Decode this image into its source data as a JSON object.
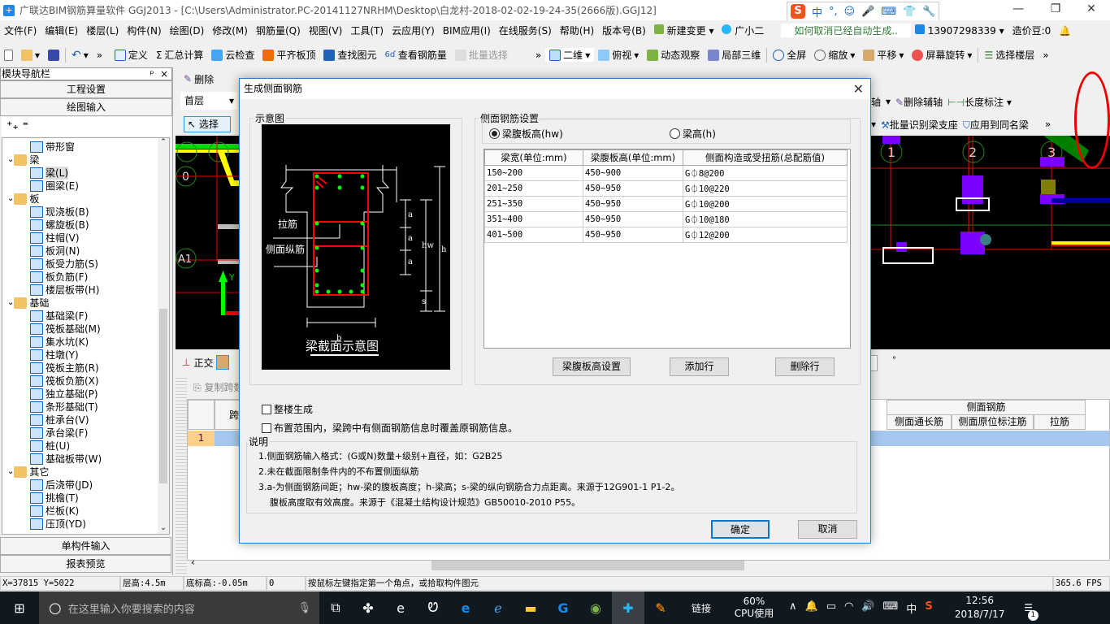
{
  "window": {
    "title": "广联达BIM钢筋算量软件 GGJ2013 - [C:\\Users\\Administrator.PC-20141127NRHM\\Desktop\\白龙村-2018-02-02-19-24-35(2666版).GGJ12]",
    "minimize": "—",
    "restore": "❐",
    "close": "✕"
  },
  "ime": {
    "logo": "S",
    "items": [
      "中",
      "°,",
      "☺",
      "🎤",
      "⌨",
      "👕",
      "🔧"
    ]
  },
  "menu": {
    "items": [
      "文件(F)",
      "编辑(E)",
      "楼层(L)",
      "构件(N)",
      "绘图(D)",
      "修改(M)",
      "钢筋量(Q)",
      "视图(V)",
      "工具(T)",
      "云应用(Y)",
      "BIM应用(I)",
      "在线服务(S)",
      "帮助(H)",
      "版本号(B)"
    ],
    "new_change": "新建变更",
    "assistant": "广小二",
    "hint_link": "如何取消已经自动生成..",
    "account": "13907298339",
    "beans": "造价豆:0"
  },
  "toolbar": {
    "items": [
      "定义",
      "汇总计算",
      "云检查",
      "平齐板顶",
      "查找图元",
      "查看钢筋量",
      "批量选择"
    ],
    "view_items": [
      "二维",
      "俯视",
      "动态观察",
      "局部三维",
      "全屏",
      "缩放",
      "平移",
      "屏幕旋转",
      "选择楼层"
    ]
  },
  "draw_toolbar": {
    "delete": "删除",
    "floor": "首层",
    "select": "选择",
    "delete_aux": "删除辅轴",
    "length_dim": "长度标注",
    "batch_identify": "批量识别梁支座",
    "apply_same": "应用到同名梁",
    "ortho": "正交",
    "copy_span": "复制跨数据",
    "aux_partial": "辅轴"
  },
  "nav": {
    "title": "模块导航栏",
    "pin": "ᵖ",
    "close": "×",
    "project_settings": "工程设置",
    "drawing_input": "绘图输入",
    "single_input": "单构件输入",
    "report_preview": "报表预览",
    "tree": [
      {
        "label": "带形窗",
        "type": "leaf",
        "level": 2
      },
      {
        "label": "梁",
        "type": "folder",
        "level": 1
      },
      {
        "label": "梁(L)",
        "type": "leaf",
        "level": 2,
        "selected": true
      },
      {
        "label": "圈梁(E)",
        "type": "leaf",
        "level": 2
      },
      {
        "label": "板",
        "type": "folder",
        "level": 1
      },
      {
        "label": "现浇板(B)",
        "type": "leaf",
        "level": 2
      },
      {
        "label": "螺旋板(B)",
        "type": "leaf",
        "level": 2
      },
      {
        "label": "柱帽(V)",
        "type": "leaf",
        "level": 2
      },
      {
        "label": "板洞(N)",
        "type": "leaf",
        "level": 2
      },
      {
        "label": "板受力筋(S)",
        "type": "leaf",
        "level": 2
      },
      {
        "label": "板负筋(F)",
        "type": "leaf",
        "level": 2
      },
      {
        "label": "楼层板带(H)",
        "type": "leaf",
        "level": 2
      },
      {
        "label": "基础",
        "type": "folder",
        "level": 1
      },
      {
        "label": "基础梁(F)",
        "type": "leaf",
        "level": 2
      },
      {
        "label": "筏板基础(M)",
        "type": "leaf",
        "level": 2
      },
      {
        "label": "集水坑(K)",
        "type": "leaf",
        "level": 2
      },
      {
        "label": "柱墩(Y)",
        "type": "leaf",
        "level": 2
      },
      {
        "label": "筏板主筋(R)",
        "type": "leaf",
        "level": 2
      },
      {
        "label": "筏板负筋(X)",
        "type": "leaf",
        "level": 2
      },
      {
        "label": "独立基础(P)",
        "type": "leaf",
        "level": 2
      },
      {
        "label": "条形基础(T)",
        "type": "leaf",
        "level": 2
      },
      {
        "label": "桩承台(V)",
        "type": "leaf",
        "level": 2
      },
      {
        "label": "承台梁(F)",
        "type": "leaf",
        "level": 2
      },
      {
        "label": "桩(U)",
        "type": "leaf",
        "level": 2
      },
      {
        "label": "基础板带(W)",
        "type": "leaf",
        "level": 2
      },
      {
        "label": "其它",
        "type": "folder",
        "level": 1
      },
      {
        "label": "后浇带(JD)",
        "type": "leaf",
        "level": 2
      },
      {
        "label": "挑檐(T)",
        "type": "leaf",
        "level": 2
      },
      {
        "label": "栏板(K)",
        "type": "leaf",
        "level": 2
      },
      {
        "label": "压顶(YD)",
        "type": "leaf",
        "level": 2
      }
    ]
  },
  "canvas": {
    "axis_labels_left": [
      "0",
      "A1"
    ],
    "axis_labels_right": [
      "1",
      "2",
      "3"
    ],
    "y_axis": "Y"
  },
  "grid": {
    "col_span": "跨号",
    "row_no": "1",
    "side_rebar_group": "侧面钢筋",
    "cols": [
      "侧面通长筋",
      "侧面原位标注筋",
      "拉筋"
    ]
  },
  "dialog": {
    "title": "生成侧面钢筋",
    "close": "✕",
    "diagram": {
      "legend": "示意图",
      "tie": "拉筋",
      "side_long": "侧面纵筋",
      "caption": "梁截面示意图",
      "dims": {
        "a": "a",
        "hw": "hw",
        "h": "h",
        "s": "s",
        "b": "b"
      }
    },
    "settings": {
      "legend": "侧面钢筋设置",
      "radio_hw": "梁腹板高(hw)",
      "radio_h": "梁高(h)",
      "radio_selected": "hw",
      "headers": [
        "梁宽(单位:mm)",
        "梁腹板高(单位:mm)",
        "侧面构造或受扭筋(总配筋值)"
      ],
      "rows": [
        [
          "150~200",
          "450~900",
          "G⏀8@200"
        ],
        [
          "201~250",
          "450~950",
          "G⏀10@220"
        ],
        [
          "251~350",
          "450~950",
          "G⏀10@200"
        ],
        [
          "351~400",
          "450~950",
          "G⏀10@180"
        ],
        [
          "401~500",
          "450~950",
          "G⏀12@200"
        ]
      ],
      "btn_web_height": "梁腹板高设置",
      "btn_add_row": "添加行",
      "btn_delete_row": "删除行"
    },
    "chk_whole_building": "整楼生成",
    "chk_whole_building_checked": false,
    "chk_override": "布置范围内，梁跨中有侧面钢筋信息时覆盖原钢筋信息。",
    "chk_override_checked": false,
    "notes_legend": "说明",
    "notes": [
      "1.侧面钢筋输入格式：(G或N)数量+级别+直径，如：G2B25",
      "2.未在截面限制条件内的不布置侧面纵筋",
      "3.a-为侧面钢筋间距；hw-梁的腹板高度；h-梁高；s-梁的纵向钢筋合力点距离。来源于12G901-1 P1-2。",
      "    腹板高度取有效高度。来源于《混凝土结构设计规范》GB50010-2010 P55。"
    ],
    "ok": "确定",
    "cancel": "取消"
  },
  "status": {
    "coords": "X=37815 Y=5022",
    "floor_height": "层高:4.5m",
    "bottom_elev": "底标高:-0.05m",
    "value": "0",
    "hint": "按鼠标左键指定第一个角点，或拾取构件图元",
    "fps": "365.6 FPS"
  },
  "taskbar": {
    "search_placeholder": "在这里输入你要搜索的内容",
    "link": "链接",
    "cpu_percent": "60%",
    "cpu_label": "CPU使用",
    "ime_lang": "中",
    "time": "12:56",
    "date": "2018/7/17",
    "notif_count": "1"
  }
}
